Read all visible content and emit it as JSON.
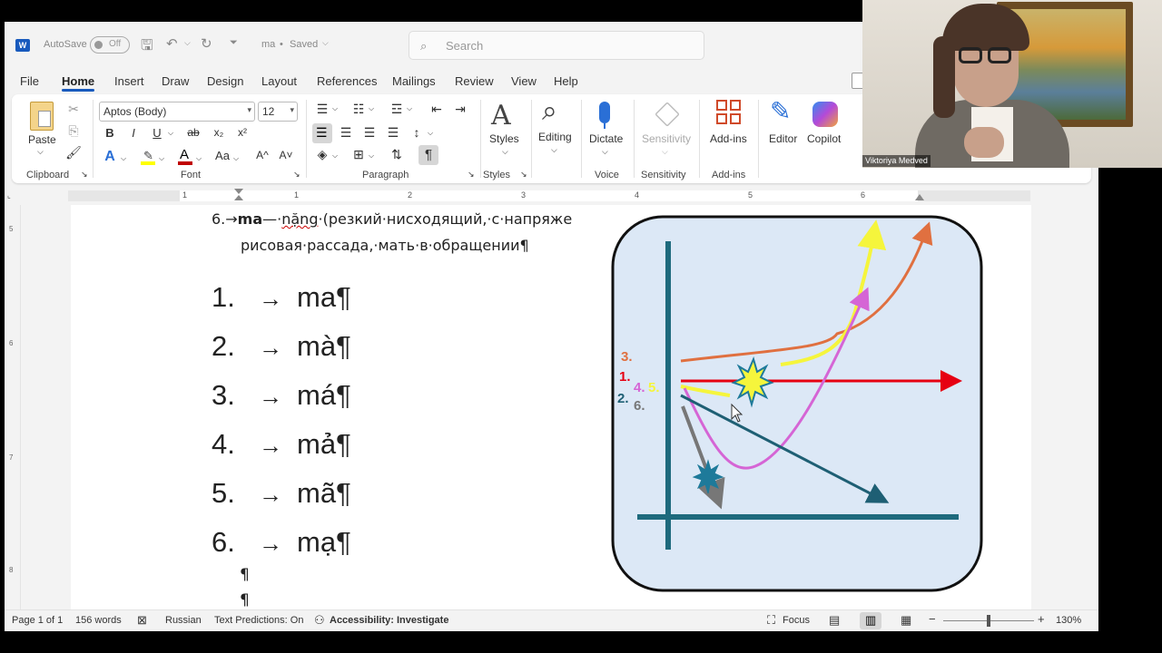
{
  "titlebar": {
    "app_icon": "W",
    "autosave_label": "AutoSave",
    "autosave_state": "Off",
    "doc_name": "ma",
    "saved_status": "Saved",
    "search_placeholder": "Search"
  },
  "menu": {
    "tabs": [
      "File",
      "Home",
      "Insert",
      "Draw",
      "Design",
      "Layout",
      "References",
      "Mailings",
      "Review",
      "View",
      "Help"
    ],
    "active": "Home"
  },
  "ribbon": {
    "clipboard": {
      "paste": "Paste",
      "label": "Clipboard"
    },
    "font": {
      "name": "Aptos (Body)",
      "size": "12",
      "label": "Font",
      "bold": "B",
      "italic": "I",
      "underline": "U",
      "strike": "ab",
      "sub": "x₂",
      "sup": "x²",
      "grow": "A^",
      "shrink": "A˅",
      "case": "Aa",
      "text_effects": "A",
      "font_color": "A"
    },
    "paragraph": {
      "label": "Paragraph",
      "pilcrow": "¶"
    },
    "styles": {
      "label": "Styles",
      "button": "Styles"
    },
    "editing": {
      "button": "Editing"
    },
    "voice": {
      "button": "Dictate",
      "label": "Voice"
    },
    "sensitivity": {
      "button": "Sensitivity",
      "label": "Sensitivity"
    },
    "addins": {
      "button": "Add-ins",
      "label": "Add-ins"
    },
    "editor": {
      "button": "Editor"
    },
    "copilot": {
      "button": "Copilot"
    }
  },
  "ruler": {
    "numbers": [
      "1",
      "1",
      "2",
      "3",
      "4",
      "5",
      "6"
    ],
    "vertical_numbers": [
      "5",
      "6",
      "7",
      "8"
    ]
  },
  "document": {
    "line1_prefix": "6.→",
    "line1_word": "ma",
    "line1_dash": "—·",
    "line1_nang": "nặng",
    "line1_rest": "·(резкий·нисходящий,·с·напряже",
    "line2": "рисовая·рассада,·мать·в·обращении¶",
    "list": [
      {
        "num": "1.",
        "arrow": "→",
        "text": "ma¶"
      },
      {
        "num": "2.",
        "arrow": "→",
        "text": "mà¶"
      },
      {
        "num": "3.",
        "arrow": "→",
        "text": "má¶"
      },
      {
        "num": "4.",
        "arrow": "→",
        "text": "mả¶"
      },
      {
        "num": "5.",
        "arrow": "→",
        "text": "mã¶"
      },
      {
        "num": "6.",
        "arrow": "→",
        "text": "mạ¶"
      }
    ],
    "empty_pilcrow": "¶"
  },
  "diagram": {
    "labels": [
      "3.",
      "1.",
      "4.",
      "5.",
      "2.",
      "6."
    ],
    "colors": {
      "background": "#dce8f6",
      "axis": "#1e6a7d",
      "red": "#e60012",
      "orange": "#e07040",
      "yellow": "#f5f53c",
      "magenta": "#d565d5",
      "teal": "#1e5f74",
      "gray": "#777777"
    }
  },
  "statusbar": {
    "page": "Page 1 of 1",
    "words": "156 words",
    "language": "Russian",
    "predictions": "Text Predictions: On",
    "accessibility": "Accessibility: Investigate",
    "focus": "Focus",
    "zoom": "130%"
  },
  "webcam": {
    "name": "Viktoriya Medved"
  }
}
